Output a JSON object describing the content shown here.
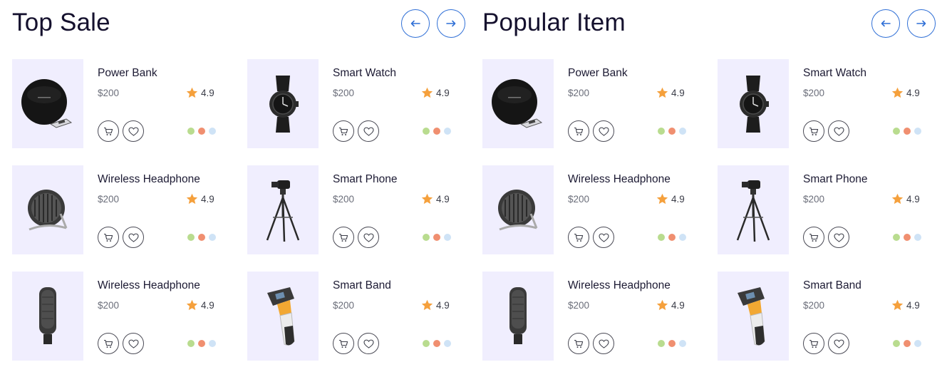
{
  "sections": [
    {
      "title": "Top Sale",
      "products": [
        {
          "name": "Power Bank",
          "price": "$200",
          "rating": "4.9",
          "icon": "power-bank"
        },
        {
          "name": "Smart Watch",
          "price": "$200",
          "rating": "4.9",
          "icon": "smart-watch"
        },
        {
          "name": "Wireless Headphone",
          "price": "$200",
          "rating": "4.9",
          "icon": "desk-fan"
        },
        {
          "name": "Smart Phone",
          "price": "$200",
          "rating": "4.9",
          "icon": "camera-tripod"
        },
        {
          "name": "Wireless Headphone",
          "price": "$200",
          "rating": "4.9",
          "icon": "microphone"
        },
        {
          "name": "Smart Band",
          "price": "$200",
          "rating": "4.9",
          "icon": "barcode-scanner"
        }
      ]
    },
    {
      "title": "Popular Item",
      "products": [
        {
          "name": "Power Bank",
          "price": "$200",
          "rating": "4.9",
          "icon": "power-bank"
        },
        {
          "name": "Smart Watch",
          "price": "$200",
          "rating": "4.9",
          "icon": "smart-watch"
        },
        {
          "name": "Wireless Headphone",
          "price": "$200",
          "rating": "4.9",
          "icon": "desk-fan"
        },
        {
          "name": "Smart Phone",
          "price": "$200",
          "rating": "4.9",
          "icon": "camera-tripod"
        },
        {
          "name": "Wireless Headphone",
          "price": "$200",
          "rating": "4.9",
          "icon": "microphone"
        },
        {
          "name": "Smart Band",
          "price": "$200",
          "rating": "4.9",
          "icon": "barcode-scanner"
        }
      ]
    }
  ],
  "colors": {
    "accent": "#2f6fd6",
    "star": "#f5a03c",
    "thumb_bg": "#f0eefe",
    "swatches": [
      "#b9dc8f",
      "#f08f70",
      "#cfe3f6"
    ]
  }
}
